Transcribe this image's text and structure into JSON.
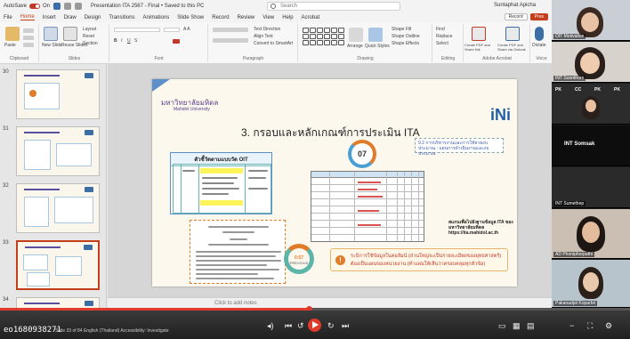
{
  "titlebar": {
    "autosave_label": "AutoSave",
    "autosave_state": "On",
    "document_title": "Presentation ITA 2567 - Final • Saved to this PC",
    "search_placeholder": "Search",
    "user_name": "Suntaphat Apicha"
  },
  "menu": {
    "items": [
      "File",
      "Home",
      "Insert",
      "Draw",
      "Design",
      "Transitions",
      "Animations",
      "Slide Show",
      "Record",
      "Review",
      "View",
      "Help",
      "Acrobat"
    ],
    "active": "Home",
    "record_label": "Record",
    "present_label": "Pres"
  },
  "ribbon": {
    "groups": [
      "Clipboard",
      "Slides",
      "Font",
      "Paragraph",
      "Drawing",
      "Editing",
      "Adobe Acrobat",
      "Voice"
    ],
    "paste_label": "Paste",
    "new_slide_label": "New Slide",
    "reuse_slides_label": "Reuse Slides",
    "layout_label": "Layout",
    "reset_label": "Reset",
    "section_label": "Section",
    "text_direction_label": "Text Direction",
    "align_text_label": "Align Text",
    "convert_smartart_label": "Convert to SmartArt",
    "arrange_label": "Arrange",
    "quick_styles_label": "Quick Styles",
    "shape_fill_label": "Shape Fill",
    "shape_outline_label": "Shape Outline",
    "shape_effects_label": "Shape Effects",
    "find_label": "Find",
    "replace_label": "Replace",
    "select_label": "Select",
    "create_pdf_label": "Create PDF and Share link",
    "create_pdf_outlook_label": "Create PDF and Share via Outlook",
    "dictate_label": "Dictate"
  },
  "thumbnails": {
    "numbers": [
      "30",
      "31",
      "32",
      "33",
      "34"
    ],
    "selected": "33"
  },
  "slide": {
    "university_name": "มหาวิทยาลัยมหิดล",
    "university_sub": "Mahidol University",
    "title": "3. กรอบและหลักเกณฑ์การประเมิน ITA",
    "circle_number": "07",
    "logo_text": "iNi",
    "annotation": "9.2 การบริหารงานและการใช้จ่ายงบประมาณ : แผนการดำเนินงานและงบประมาณ",
    "cit_header": "ตัวชี้วัดตามแบบวัด OIT",
    "qr_text": "สแกนเพื่อไปยังฐานข้อมูล ITA ของมหาวิทยาลัยมหิดล https://ita.mahidol.ac.th",
    "timer_value": "0:57",
    "timer_label": "PREVIOUS",
    "note_line1": "ระบิการใช้ข้อมูลในคอลัมน์ (ส่วนใหญ่จะเป็นรายละเอียดของยุทธศาสตร์)",
    "note_line2": "ต้องเป็นแผนของหน่วยงาน (ทำแผนให้เห็นว่าครอบคลุมทุกหัวข้อ)"
  },
  "notes_placeholder": "Click to add notes",
  "player": {
    "timecode": "eo1680938271",
    "status": "Slide 33 of 84   English (Thailand)   Accessibility: Investigate",
    "progress_fraction": 0.49
  },
  "gallery": {
    "participants": [
      {
        "name": "OIT Motivation",
        "kind": "person"
      },
      {
        "name": "INT Soonthorn",
        "kind": "person"
      },
      {
        "name": "",
        "kind": "grid"
      },
      {
        "name": "INT Somsak",
        "kind": "person"
      },
      {
        "name": "INT Sumethep",
        "kind": "text"
      },
      {
        "name": "",
        "kind": "person"
      },
      {
        "name": "AD Phoniphorpathi",
        "kind": "person"
      },
      {
        "name": "Pakanadpit Koparbit",
        "kind": "person"
      }
    ],
    "grid_labels": [
      "PK",
      "CC",
      "PK",
      "PK"
    ]
  },
  "colors": {
    "accent": "#c43e1c",
    "progress": "#e03a2a",
    "slide_bg": "#fdf8ee",
    "slide_title_purple": "#5a3c8c",
    "orange": "#e07b2a",
    "teal": "#5bb5a8"
  }
}
